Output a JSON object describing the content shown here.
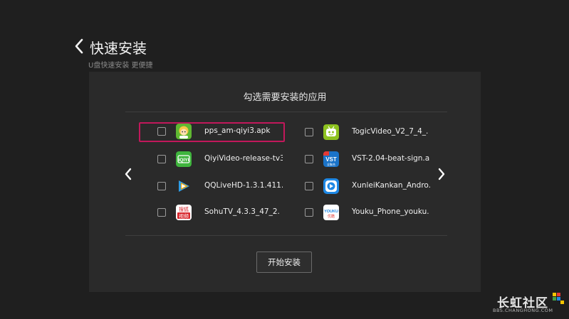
{
  "header": {
    "title": "快速安装",
    "subtitle": "U盘快速安装 更便捷"
  },
  "panel": {
    "title": "勾选需要安装的应用",
    "install_button": "开始安装"
  },
  "apps": [
    {
      "name": "pps_am-qiyi3.apk",
      "checked": false,
      "selected": true,
      "icon": "pps-icon"
    },
    {
      "name": "QiyiVideo-release-tv3.",
      "checked": false,
      "selected": false,
      "icon": "iqiyi-icon"
    },
    {
      "name": "QQLiveHD-1.3.1.411.",
      "checked": false,
      "selected": false,
      "icon": "tencent-video-icon"
    },
    {
      "name": "SohuTV_4.3.3_47_2.",
      "checked": false,
      "selected": false,
      "icon": "sohu-video-icon"
    },
    {
      "name": "TogicVideo_V2_7_4_.",
      "checked": false,
      "selected": false,
      "icon": "togic-icon"
    },
    {
      "name": "VST-2.04-beat-sign.a.",
      "checked": false,
      "selected": false,
      "icon": "vst-icon"
    },
    {
      "name": "XunleiKankan_Andro.",
      "checked": false,
      "selected": false,
      "icon": "xunlei-icon"
    },
    {
      "name": "Youku_Phone_youku.",
      "checked": false,
      "selected": false,
      "icon": "youku-icon"
    }
  ],
  "icon_labels": {
    "iqiyi": "iQIYI",
    "sohu_top": "搜狐",
    "sohu_bottom": "视频",
    "vst": "VST",
    "vst_sub": "全聚合",
    "youku": "YOUKU",
    "youku_sub": "优酷"
  },
  "watermark": {
    "text": "长虹社区",
    "url": "BBS.CHANGHONG.COM"
  },
  "colors": {
    "background": "#1f1f1f",
    "panel": "#2a2a2a",
    "selection": "#c2185b"
  }
}
